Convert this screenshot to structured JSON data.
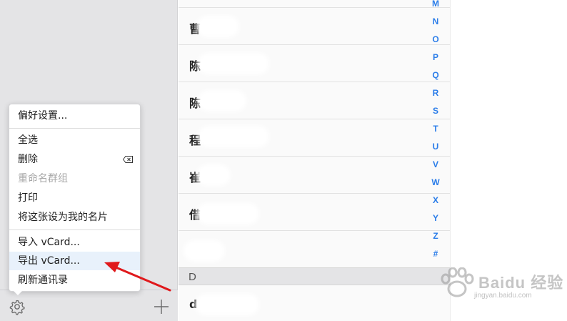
{
  "menu": {
    "items": [
      {
        "label": "偏好设置...",
        "disabled": false
      },
      {
        "label": "全选",
        "disabled": false
      },
      {
        "label": "删除",
        "disabled": false
      },
      {
        "label": "重命名群组",
        "disabled": true
      },
      {
        "label": "打印",
        "disabled": false
      },
      {
        "label": "将这张设为我的名片",
        "disabled": false
      },
      {
        "label": "导入 vCard...",
        "disabled": false
      },
      {
        "label": "导出 vCard...",
        "disabled": false
      },
      {
        "label": "刷新通讯录",
        "disabled": false
      }
    ]
  },
  "contacts": {
    "rows": [
      {
        "name": "曹"
      },
      {
        "name": "陈"
      },
      {
        "name": "陈"
      },
      {
        "name": "程"
      },
      {
        "name": "崔"
      },
      {
        "name": "借"
      },
      {
        "name": ""
      }
    ],
    "section_header": "D",
    "section_rows": [
      {
        "name": "d"
      }
    ]
  },
  "index_letters": [
    "M",
    "N",
    "O",
    "P",
    "Q",
    "R",
    "S",
    "T",
    "U",
    "V",
    "W",
    "X",
    "Y",
    "Z",
    "#"
  ],
  "watermark": {
    "main": "Baidu 经验",
    "sub": "jingyan.baidu.com"
  },
  "colors": {
    "accent": "#2b7de9",
    "arrow": "#e0191c",
    "highlight": "#e8f1fb"
  },
  "icons": {
    "settings": "gear-icon",
    "add": "plus-icon",
    "delete_key": "delete-key-icon"
  }
}
